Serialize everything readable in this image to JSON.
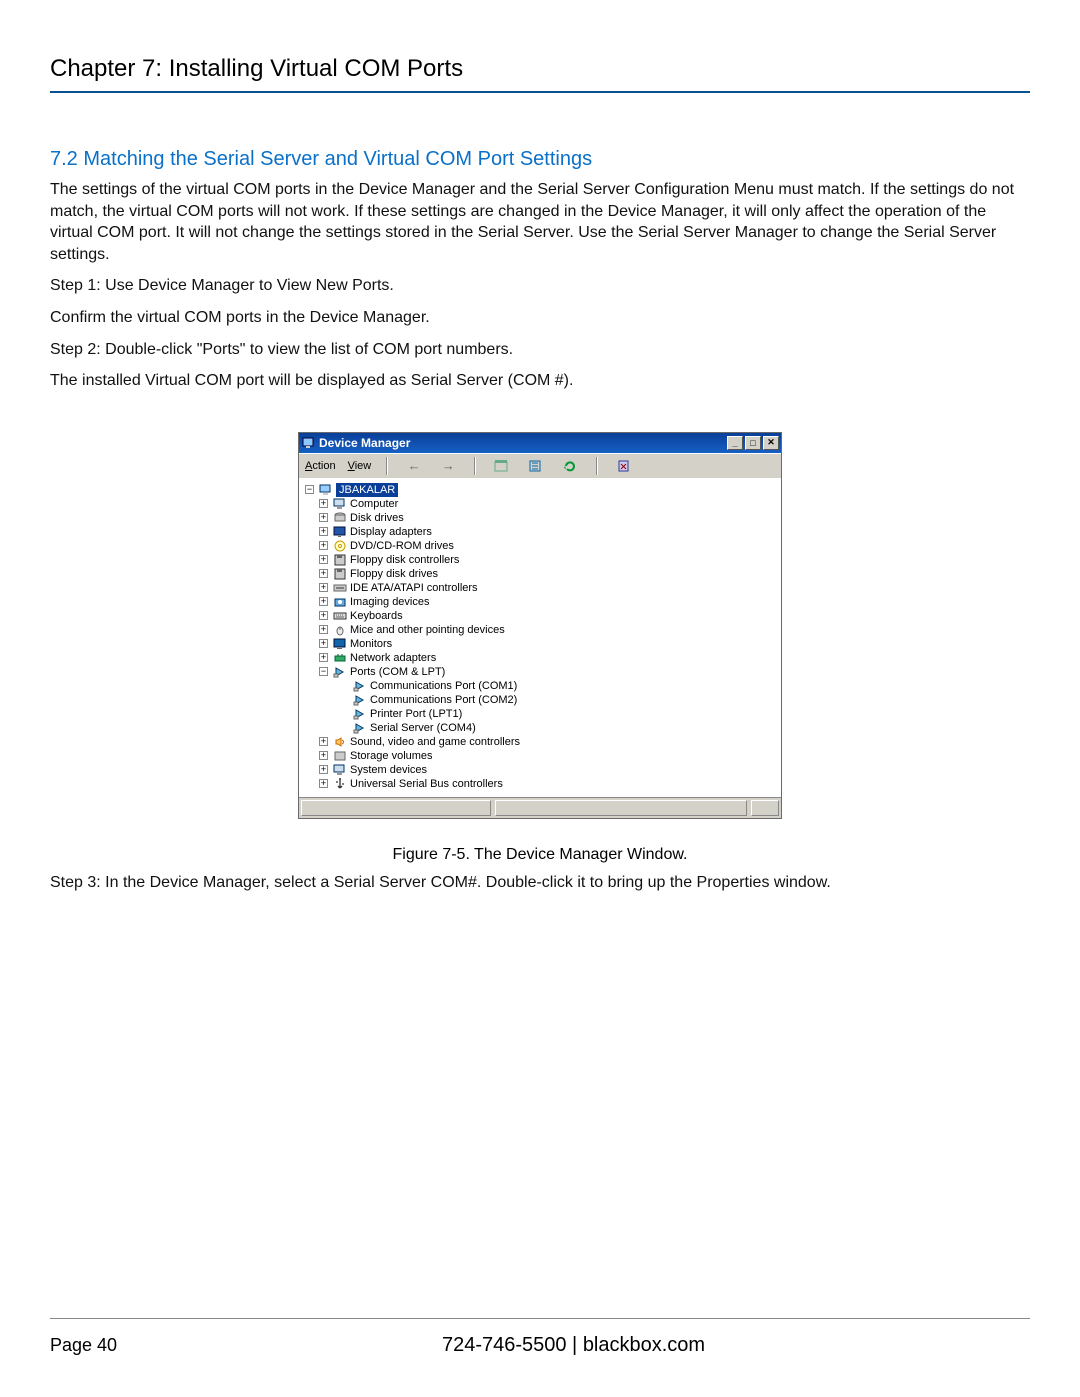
{
  "chapter_title": "Chapter 7: Installing Virtual COM Ports",
  "section_title": "7.2 Matching the Serial Server and Virtual COM Port Settings",
  "body_p1": "The settings of the virtual COM ports in the Device Manager and the Serial Server Configuration Menu must match. If the settings do not match, the virtual COM ports will not work. If these settings are changed in the Device Manager, it will only affect the operation of the virtual COM port. It will not change the settings stored in the Serial Server. Use the Serial Server Manager to change the Serial Server settings.",
  "step1": "Step 1: Use Device Manager to View New Ports.",
  "confirm": "Confirm the virtual COM ports in the Device Manager.",
  "step2": "Step 2: Double-click \"Ports\" to view the list of COM port numbers.",
  "installed": "The installed Virtual COM port will be displayed as Serial Server (COM #).",
  "figure_caption": "Figure 7-5. The Device Manager Window.",
  "step3": "Step 3: In the Device Manager, select a Serial Server COM#. Double-click it to bring up the Properties window.",
  "footer": {
    "page": "Page 40",
    "center": "724-746-5500   |   blackbox.com"
  },
  "dm": {
    "title": "Device Manager",
    "menu_action": "Action",
    "menu_view": "View",
    "root": "JBAKALAR",
    "nodes": [
      {
        "label": "Computer",
        "icon": "computer",
        "exp": "+"
      },
      {
        "label": "Disk drives",
        "icon": "disk",
        "exp": "+"
      },
      {
        "label": "Display adapters",
        "icon": "display",
        "exp": "+"
      },
      {
        "label": "DVD/CD-ROM drives",
        "icon": "cd",
        "exp": "+"
      },
      {
        "label": "Floppy disk controllers",
        "icon": "floppy",
        "exp": "+"
      },
      {
        "label": "Floppy disk drives",
        "icon": "floppy",
        "exp": "+"
      },
      {
        "label": "IDE ATA/ATAPI controllers",
        "icon": "ide",
        "exp": "+"
      },
      {
        "label": "Imaging devices",
        "icon": "imaging",
        "exp": "+"
      },
      {
        "label": "Keyboards",
        "icon": "keyboard",
        "exp": "+"
      },
      {
        "label": "Mice and other pointing devices",
        "icon": "mouse",
        "exp": "+"
      },
      {
        "label": "Monitors",
        "icon": "monitor",
        "exp": "+"
      },
      {
        "label": "Network adapters",
        "icon": "network",
        "exp": "+"
      },
      {
        "label": "Ports (COM & LPT)",
        "icon": "port",
        "exp": "-",
        "children": [
          {
            "label": "Communications Port (COM1)",
            "icon": "port"
          },
          {
            "label": "Communications Port (COM2)",
            "icon": "port"
          },
          {
            "label": "Printer Port (LPT1)",
            "icon": "port"
          },
          {
            "label": "Serial Server (COM4)",
            "icon": "port"
          }
        ]
      },
      {
        "label": "Sound, video and game controllers",
        "icon": "sound",
        "exp": "+"
      },
      {
        "label": "Storage volumes",
        "icon": "storage",
        "exp": "+"
      },
      {
        "label": "System devices",
        "icon": "system",
        "exp": "+"
      },
      {
        "label": "Universal Serial Bus controllers",
        "icon": "usb",
        "exp": "+"
      }
    ]
  }
}
